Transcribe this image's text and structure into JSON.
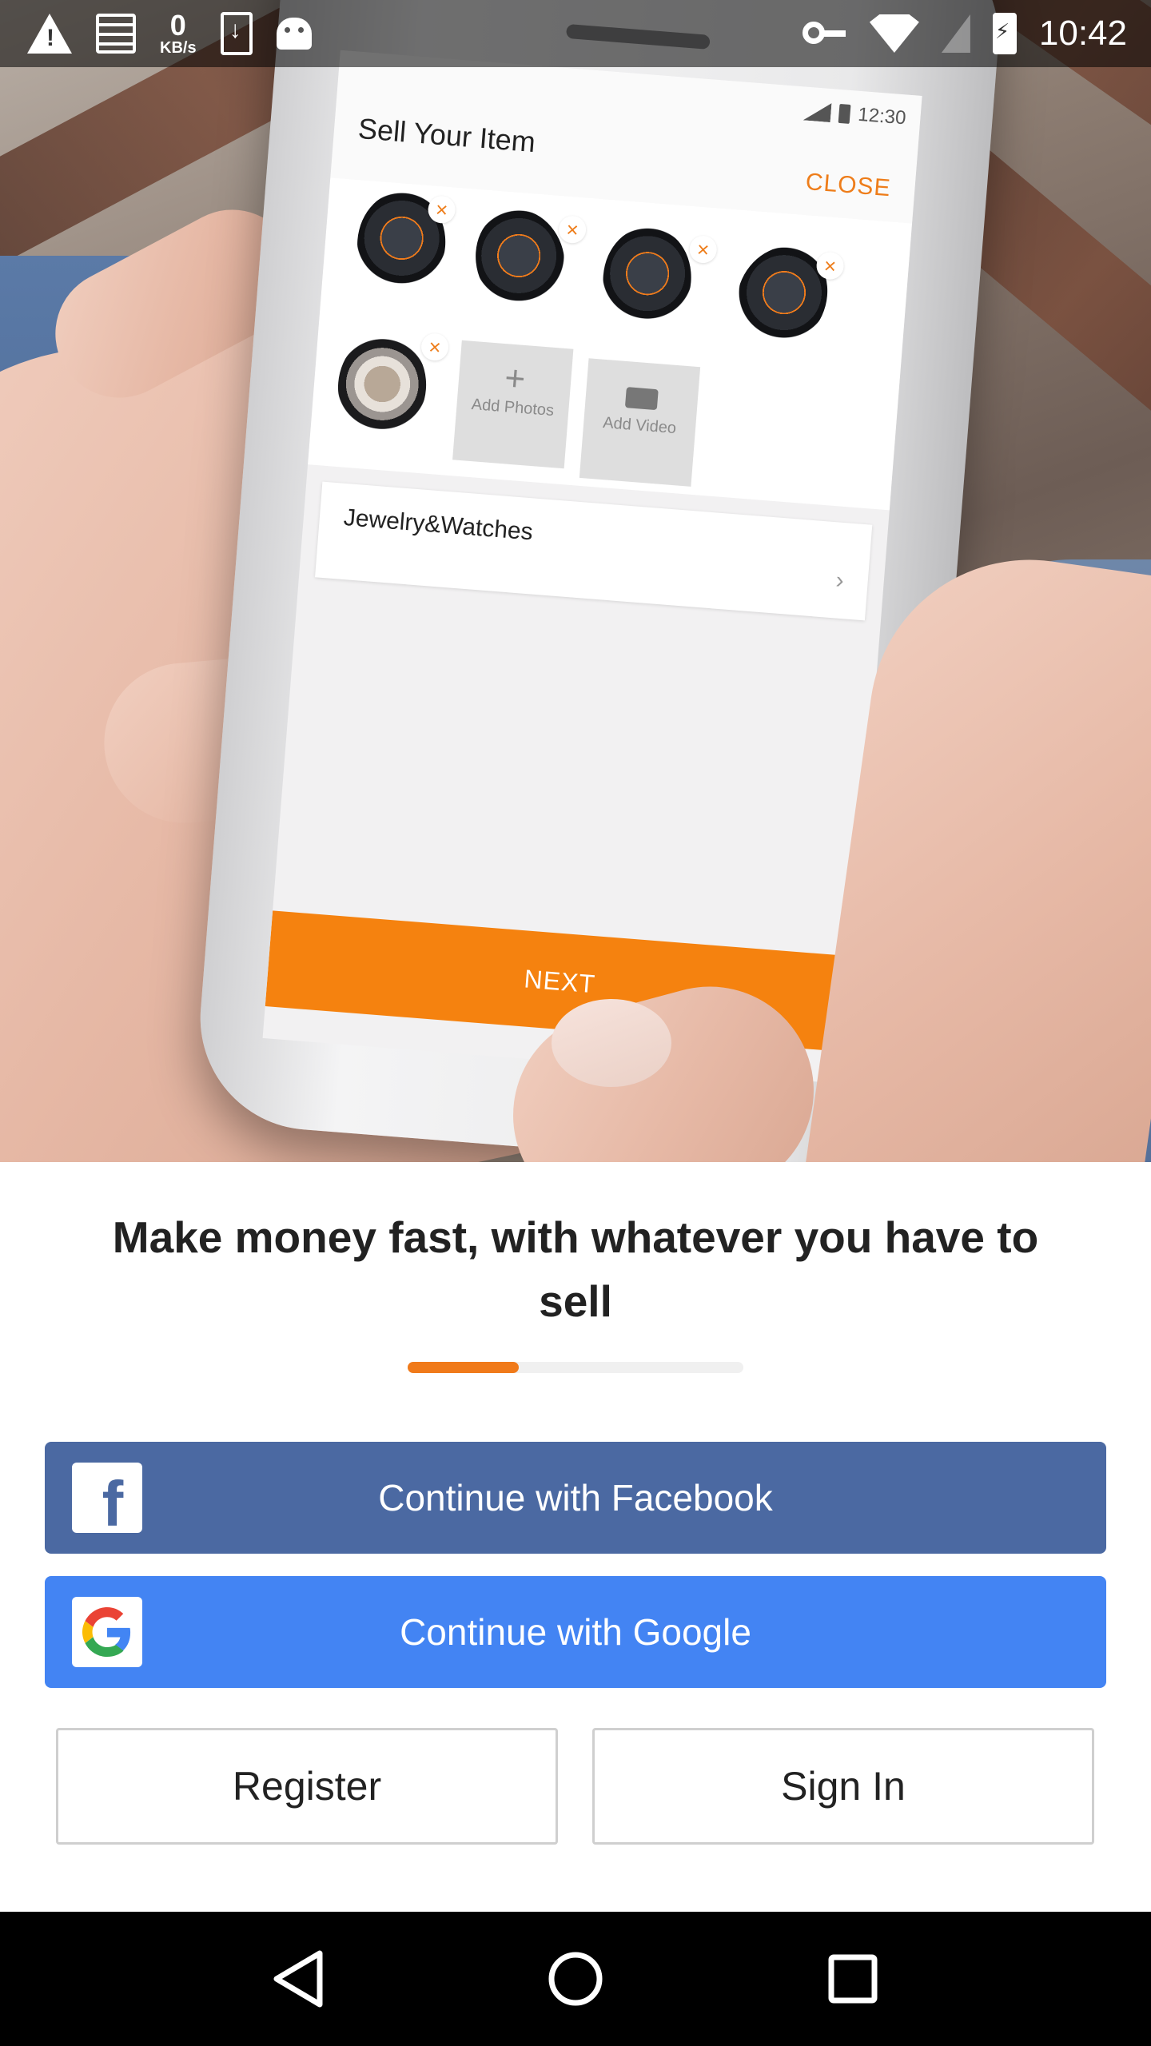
{
  "status_bar": {
    "time": "10:42",
    "net_speed_value": "0",
    "net_speed_unit": "KB/s",
    "icons": [
      "warning-icon",
      "news-icon",
      "download-icon",
      "android-icon",
      "vpn-key-icon",
      "wifi-icon",
      "cellular-icon",
      "battery-charging-icon"
    ]
  },
  "hero": {
    "phone_screen": {
      "time": "12:30",
      "title": "Sell Your Item",
      "close_label": "CLOSE",
      "remove_glyph": "×",
      "add_photos_label": "Add Photos",
      "add_video_label": "Add Video",
      "category": "Jewelry&Watches",
      "next_label": "NEXT"
    }
  },
  "onboarding": {
    "headline": "Make money fast, with whatever you have to sell",
    "progress": 0.33,
    "facebook_label": "Continue with Facebook",
    "google_label": "Continue with Google",
    "register_label": "Register",
    "signin_label": "Sign In"
  },
  "colors": {
    "accent_orange": "#f07a1a",
    "facebook_blue": "#4b69a2",
    "google_blue": "#4384f3"
  },
  "nav_bar": {
    "icons": [
      "back-icon",
      "home-icon",
      "recents-icon"
    ]
  }
}
